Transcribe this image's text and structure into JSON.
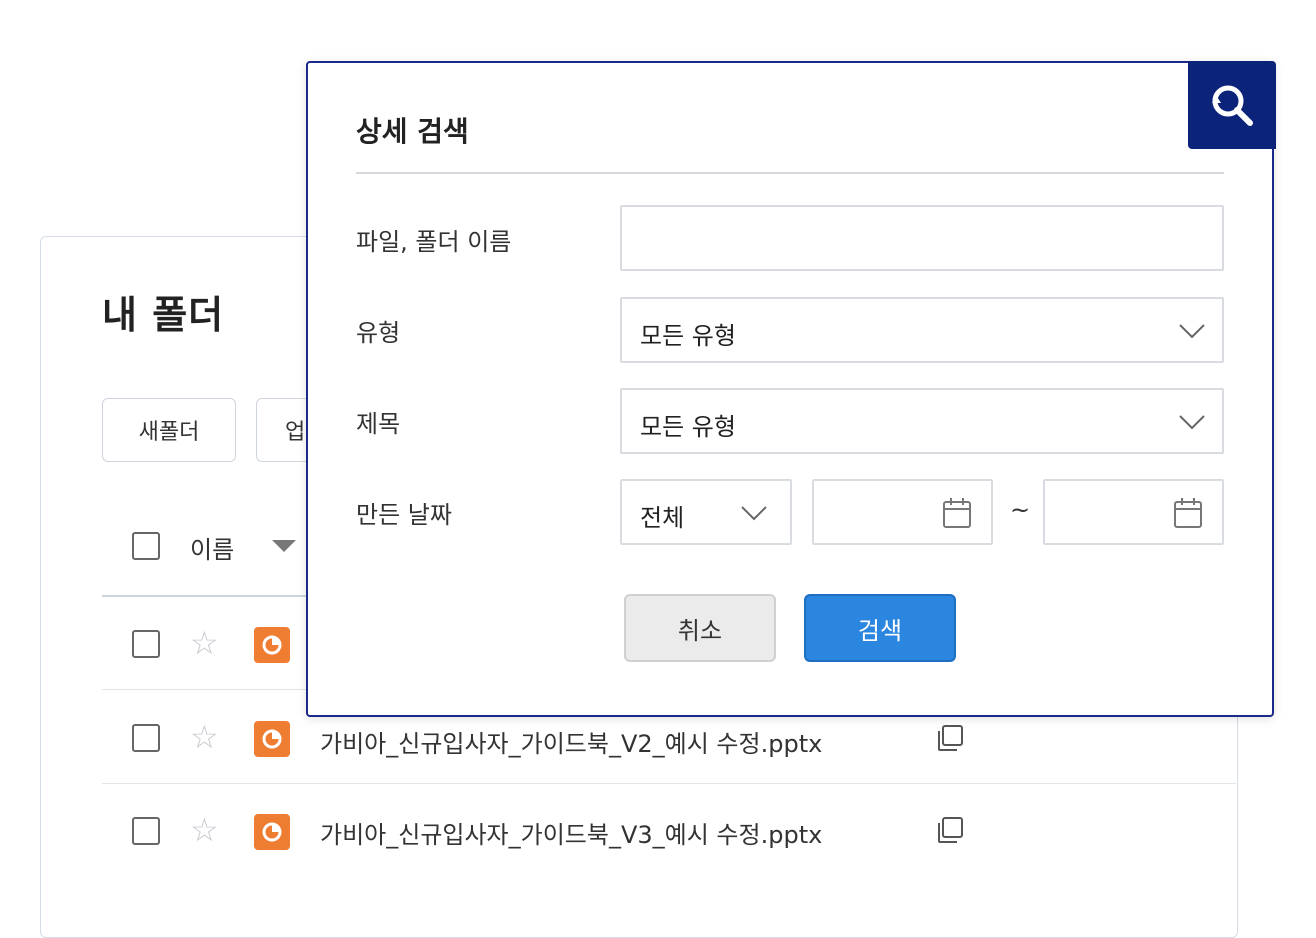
{
  "folder": {
    "title": "내 폴더",
    "new_folder_label": "새폴더",
    "upload_label_partial": "업",
    "column_name": "이름",
    "files": [
      {
        "name": "가비아_신규입사자_가이드북_V2_예시 수정.pptx"
      },
      {
        "name": "가비아_신규입사자_가이드북_V3_예시 수정.pptx"
      }
    ]
  },
  "search_modal": {
    "title": "상세 검색",
    "name_label": "파일, 폴더 이름",
    "name_value": "",
    "type_label": "유형",
    "type_value": "모든 유형",
    "subject_label": "제목",
    "subject_value": "모든 유형",
    "date_label": "만든 날짜",
    "date_range_value": "전체",
    "date_from": "",
    "date_separator": "~",
    "date_to": "",
    "cancel_label": "취소",
    "search_label": "검색"
  },
  "colors": {
    "modal_border": "#1b2a8a",
    "corner_bg": "#0b2379",
    "search_button": "#2b86e0",
    "ppt_icon": "#ee7d31"
  }
}
